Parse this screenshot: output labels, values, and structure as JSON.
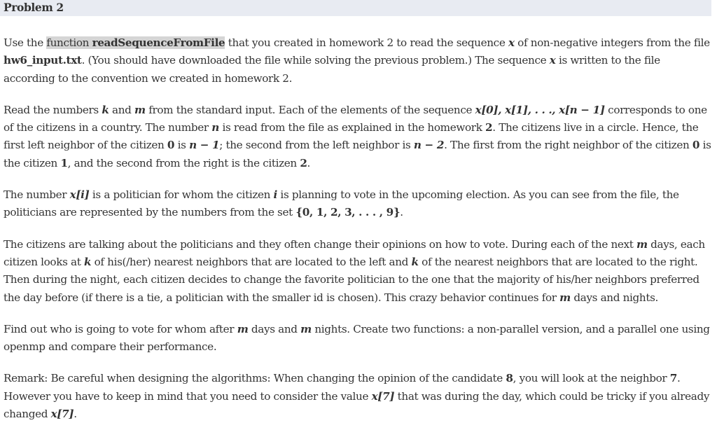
{
  "header": {
    "title": "Problem 2"
  },
  "p1": {
    "t1": "Use the ",
    "hl_plain": "function ",
    "hl_bold": "readSequenceFromFile",
    "t2": " that you created in homework 2 to read the sequence ",
    "x": "x",
    "t3": " of non-negative integers from the file ",
    "file": "hw6_input.txt",
    "t4": ". (You should have downloaded the file while solving the previous problem.) The sequence ",
    "t5": " is written to the file according to the convention we created in homework 2."
  },
  "p2": {
    "t1": "Read the numbers ",
    "k": "k",
    "t2": " and ",
    "m": "m",
    "t3": " from the standard input. Each of the elements of the sequence ",
    "seq": "x[0], x[1], . . ., x[n − 1]",
    "t4": " corresponds to one of the citizens in a country. The number ",
    "n": "n",
    "t5": " is read from the file as explained in the homework ",
    "two": "2",
    "t6": ". The citizens live in a circle. Hence, the first left neighbor of the citizen ",
    "zero": "0",
    "t7": " is ",
    "nm1": "n − 1",
    "t8": "; the second from the left neighbor is ",
    "nm2": "n − 2",
    "t9": ". The first from the right neighbor of the citizen ",
    "t10": " is the citizen ",
    "one": "1",
    "t11": ", and the second from the right is the citizen ",
    "t12": "."
  },
  "p3": {
    "t1": "The number ",
    "xi": "x[i]",
    "t2": " is a politician for whom the citizen ",
    "i": "i",
    "t3": " is planning to vote in the upcoming election. As you can see from the file, the politicians are represented by the numbers from the set ",
    "set": "{0, 1, 2, 3, . . . , 9}",
    "t4": "."
  },
  "p4": {
    "t1": "The citizens are talking about the politicians and they often change their opinions on how to vote. During each of the next ",
    "m": "m",
    "t2": " days, each citizen looks at ",
    "k": "k",
    "t3": " of his(/her) nearest neighbors that are located to the left and ",
    "t4": " of the nearest neighbors that are located to the right. Then during the night, each citizen decides to change the favorite politician to the one that the majority of his/her neighbors preferred the day before (if there is a tie, a politician with the smaller id is chosen). This crazy behavior continues for ",
    "t5": " days and nights."
  },
  "p5": {
    "t1": "Find out who is going to vote for whom after ",
    "m": "m",
    "t2": " days and ",
    "t3": " nights. Create two functions: a non-parallel version, and a parallel one using openmp and compare their performance."
  },
  "p6": {
    "t1": "Remark: Be careful when designing the algorithms: When changing the opinion of the candidate ",
    "eight": "8",
    "t2": ", you will look at the neighbor ",
    "seven": "7",
    "t3": ". However you have to keep in mind that you need to consider the value ",
    "x7": "x[7]",
    "t4": " that was during the day, which could be tricky if you already changed ",
    "t5": "."
  }
}
